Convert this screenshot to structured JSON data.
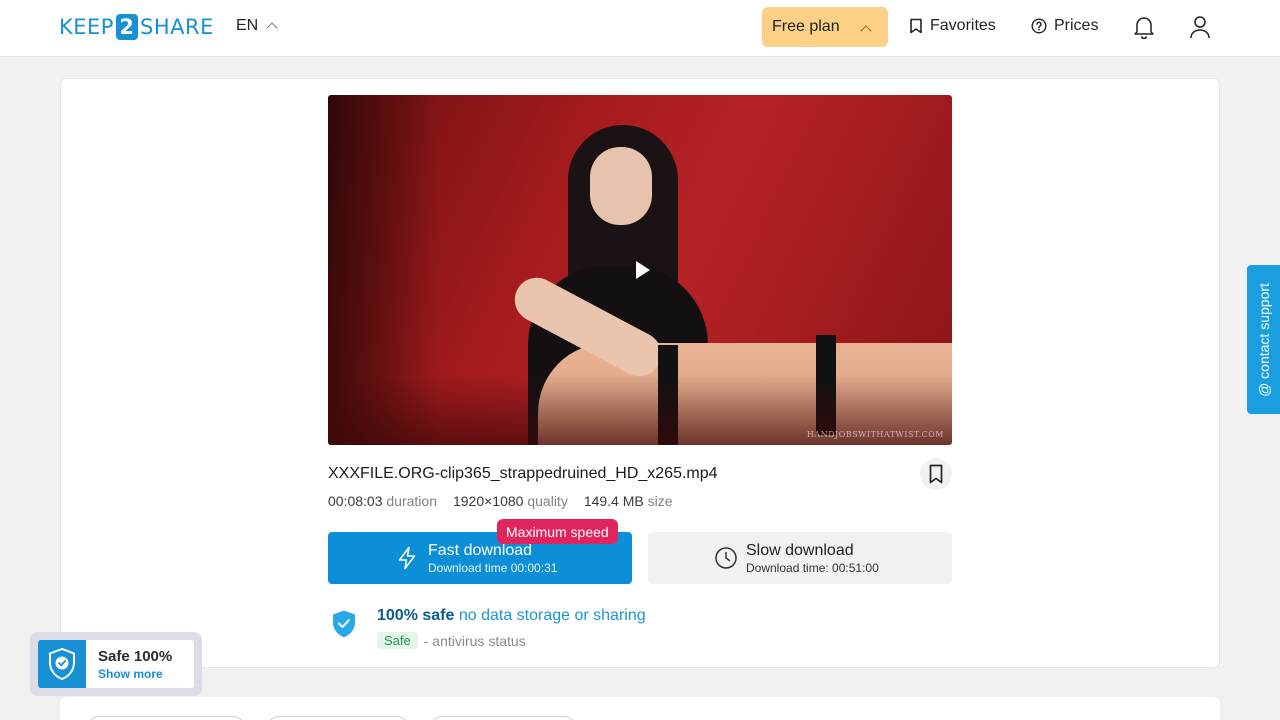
{
  "header": {
    "logo": {
      "left": "KEEP",
      "middle": "2",
      "right": "SHARE"
    },
    "language": "EN",
    "plan_label": "Free plan",
    "favorites_label": "Favorites",
    "prices_label": "Prices"
  },
  "video": {
    "watermark": "HANDJOBSWITHATWIST.COM"
  },
  "file": {
    "name": "XXXFILE.ORG-clip365_strappedruined_HD_x265.mp4",
    "duration_value": "00:08:03",
    "duration_label": "duration",
    "quality_value": "1920×1080",
    "quality_label": "quality",
    "size_value": "149.4 MB",
    "size_label": "size"
  },
  "download": {
    "badge": "Maximum speed",
    "fast_label": "Fast download",
    "fast_time": "Download time 00:00:31",
    "slow_label": "Slow download",
    "slow_time": "Download time: 00:51:00"
  },
  "safety": {
    "strong": "100% safe",
    "link": "no data storage or sharing",
    "pill": "Safe",
    "status": "- antivirus status"
  },
  "support": {
    "label": "@ contact support"
  },
  "safe_widget": {
    "title": "Safe 100%",
    "link": "Show more"
  },
  "colors": {
    "brand_blue": "#0d8fd8",
    "plan_yellow": "#fcd187",
    "badge_pink": "#e0245e",
    "support_blue": "#1a9ee0"
  }
}
